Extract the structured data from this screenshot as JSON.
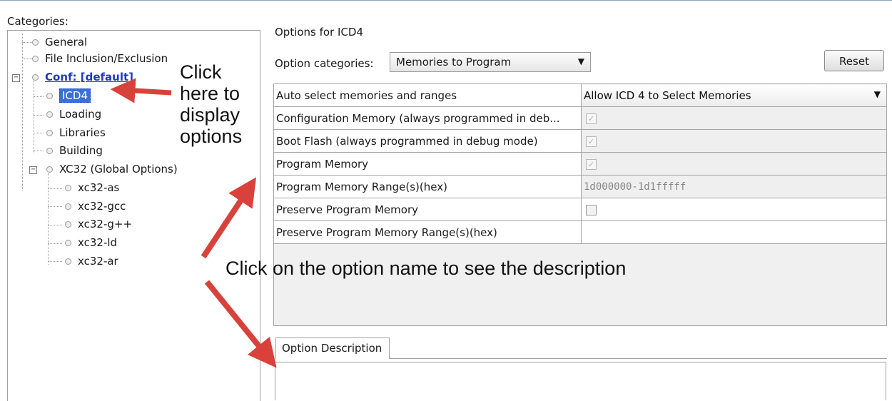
{
  "left_panel": {
    "label": "Categories:",
    "tree": [
      {
        "label": "General"
      },
      {
        "label": "File Inclusion/Exclusion"
      },
      {
        "label": "Conf: [default]"
      },
      {
        "label": "ICD4"
      },
      {
        "label": "Loading"
      },
      {
        "label": "Libraries"
      },
      {
        "label": "Building"
      },
      {
        "label": "XC32 (Global Options)"
      },
      {
        "label": "xc32-as"
      },
      {
        "label": "xc32-gcc"
      },
      {
        "label": "xc32-g++"
      },
      {
        "label": "xc32-ld"
      },
      {
        "label": "xc32-ar"
      }
    ],
    "expander_symbol": "−"
  },
  "right_panel": {
    "title": "Options for ICD4",
    "category_label": "Option categories:",
    "category_selected": "Memories to Program",
    "reset_label": "Reset",
    "options": [
      {
        "name": "Auto select memories and ranges",
        "value": "Allow ICD 4 to Select Memories"
      },
      {
        "name": "Configuration Memory (always programmed in deb...",
        "value": "✓"
      },
      {
        "name": "Boot Flash (always programmed in debug mode)",
        "value": "✓"
      },
      {
        "name": "Program Memory",
        "value": "✓"
      },
      {
        "name": "Program Memory Range(s)(hex)",
        "value": "1d000000-1d1fffff"
      },
      {
        "name": "Preserve Program Memory",
        "value": ""
      },
      {
        "name": "Preserve Program Memory Range(s)(hex)",
        "value": ""
      }
    ],
    "description_tab": "Option Description",
    "description_text": ""
  },
  "annotations": {
    "click_here": [
      "Click",
      "here to",
      "display",
      "options"
    ],
    "click_option": "Click on the option name to see the description"
  },
  "colors": {
    "arrow": "#d9423a",
    "selection": "#3a6fd9",
    "link": "#1a3cc8"
  }
}
